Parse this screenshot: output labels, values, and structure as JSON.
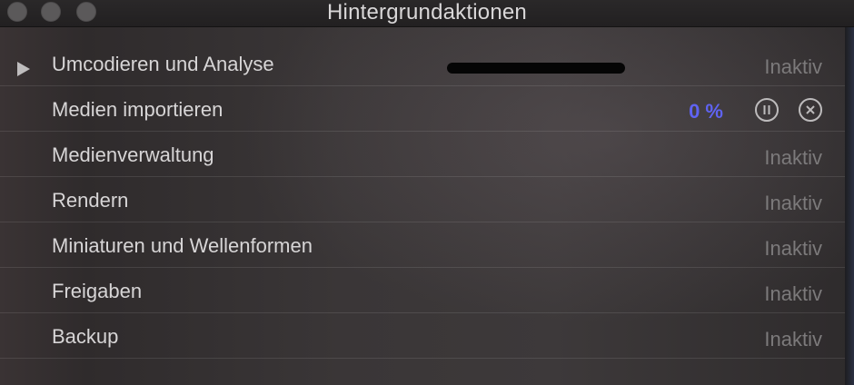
{
  "window": {
    "title": "Hintergrundaktionen"
  },
  "tasks": [
    {
      "label": "Umcodieren und Analyse",
      "status": "Inaktiv"
    },
    {
      "label": "Medien importieren",
      "progress_percent": 0,
      "progress_text": "0 %",
      "accent_color": "#5f63f2"
    },
    {
      "label": "Medienverwaltung",
      "status": "Inaktiv"
    },
    {
      "label": "Rendern",
      "status": "Inaktiv"
    },
    {
      "label": "Miniaturen und Wellenformen",
      "status": "Inaktiv"
    },
    {
      "label": "Freigaben",
      "status": "Inaktiv"
    },
    {
      "label": "Backup",
      "status": "Inaktiv"
    }
  ],
  "icons": {
    "disclosure": "disclosure-triangle-icon",
    "pause": "pause-icon",
    "cancel": "cancel-icon"
  }
}
